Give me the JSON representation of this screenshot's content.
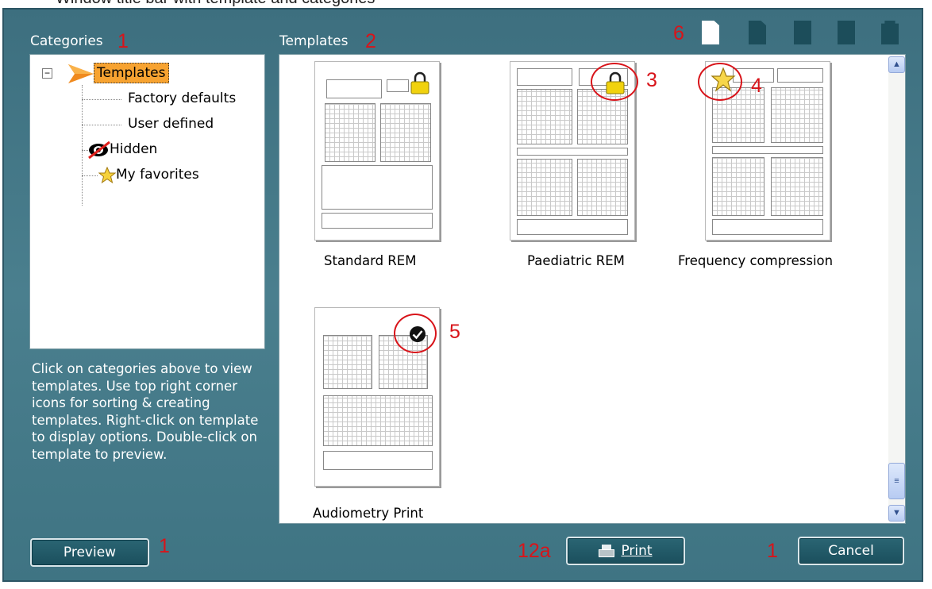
{
  "top_fragment": "Window title bar with template and categories",
  "categories_label": "Categories",
  "templates_label": "Templates",
  "tree": {
    "root": "Templates",
    "collapse_glyph": "−",
    "items": [
      "Factory defaults",
      "User defined",
      "Hidden",
      "My favorites"
    ]
  },
  "help_text": "Click on categories above to view templates. Use top right corner icons for sorting & creating templates. Right-click on template to display options. Double-click on template to preview.",
  "templates": [
    {
      "name": "Standard REM",
      "badge": "lock-icon"
    },
    {
      "name": "Paediatric REM",
      "badge": "lock-icon"
    },
    {
      "name": "Frequency compression",
      "badge": "star-icon"
    },
    {
      "name": "Audiometry Print",
      "badge": "check-icon"
    }
  ],
  "buttons": {
    "preview": "Preview",
    "print": "Print",
    "cancel": "Cancel"
  },
  "callouts": {
    "categories": "1",
    "templates": "2",
    "lock": "3",
    "star": "4",
    "check": "5",
    "toolbar": "6",
    "preview": "1",
    "print": "12a",
    "cancel": "1"
  },
  "colors": {
    "panel": "#447a89",
    "selection": "#f7a331",
    "callout": "#d8141a",
    "button": "#1e5462"
  }
}
